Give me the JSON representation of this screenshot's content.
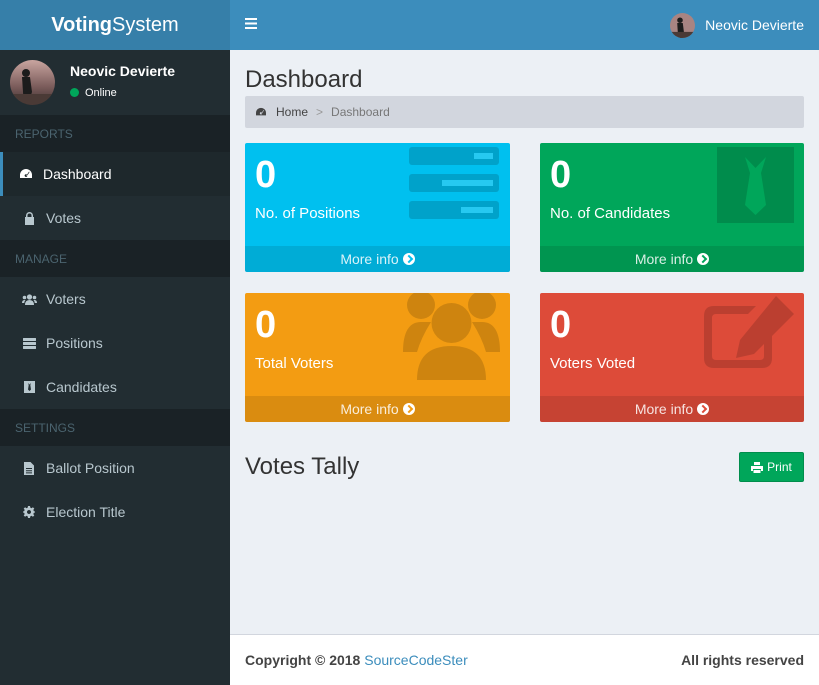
{
  "brand": {
    "bold": "Voting",
    "light": "System"
  },
  "user": {
    "name": "Neovic Devierte",
    "status": "Online"
  },
  "sidebar": {
    "sections": [
      {
        "header": "REPORTS",
        "items": [
          {
            "label": "Dashboard",
            "icon": "dashboard-icon"
          },
          {
            "label": "Votes",
            "icon": "lock-icon"
          }
        ]
      },
      {
        "header": "MANAGE",
        "items": [
          {
            "label": "Voters",
            "icon": "users-icon"
          },
          {
            "label": "Positions",
            "icon": "tasks-icon"
          },
          {
            "label": "Candidates",
            "icon": "black-tie-icon"
          }
        ]
      },
      {
        "header": "SETTINGS",
        "items": [
          {
            "label": "Ballot Position",
            "icon": "file-text-icon"
          },
          {
            "label": "Election Title",
            "icon": "cog-icon"
          }
        ]
      }
    ]
  },
  "page": {
    "title": "Dashboard"
  },
  "breadcrumb": {
    "home": "Home",
    "separator": ">",
    "current": "Dashboard"
  },
  "stats": [
    {
      "value": "0",
      "label": "No. of Positions",
      "more": "More info",
      "color": "#00c0ef",
      "icon": "tasks-icon"
    },
    {
      "value": "0",
      "label": "No. of Candidates",
      "more": "More info",
      "color": "#00a65a",
      "icon": "black-tie-icon"
    },
    {
      "value": "0",
      "label": "Total Voters",
      "more": "More info",
      "color": "#f39c12",
      "icon": "users-icon"
    },
    {
      "value": "0",
      "label": "Voters Voted",
      "more": "More info",
      "color": "#dd4b39",
      "icon": "edit-icon"
    }
  ],
  "tally": {
    "title": "Votes Tally",
    "print_label": "Print"
  },
  "footer": {
    "copyright": "Copyright © 2018",
    "link": "SourceCodeSter",
    "rights": "All rights reserved"
  }
}
